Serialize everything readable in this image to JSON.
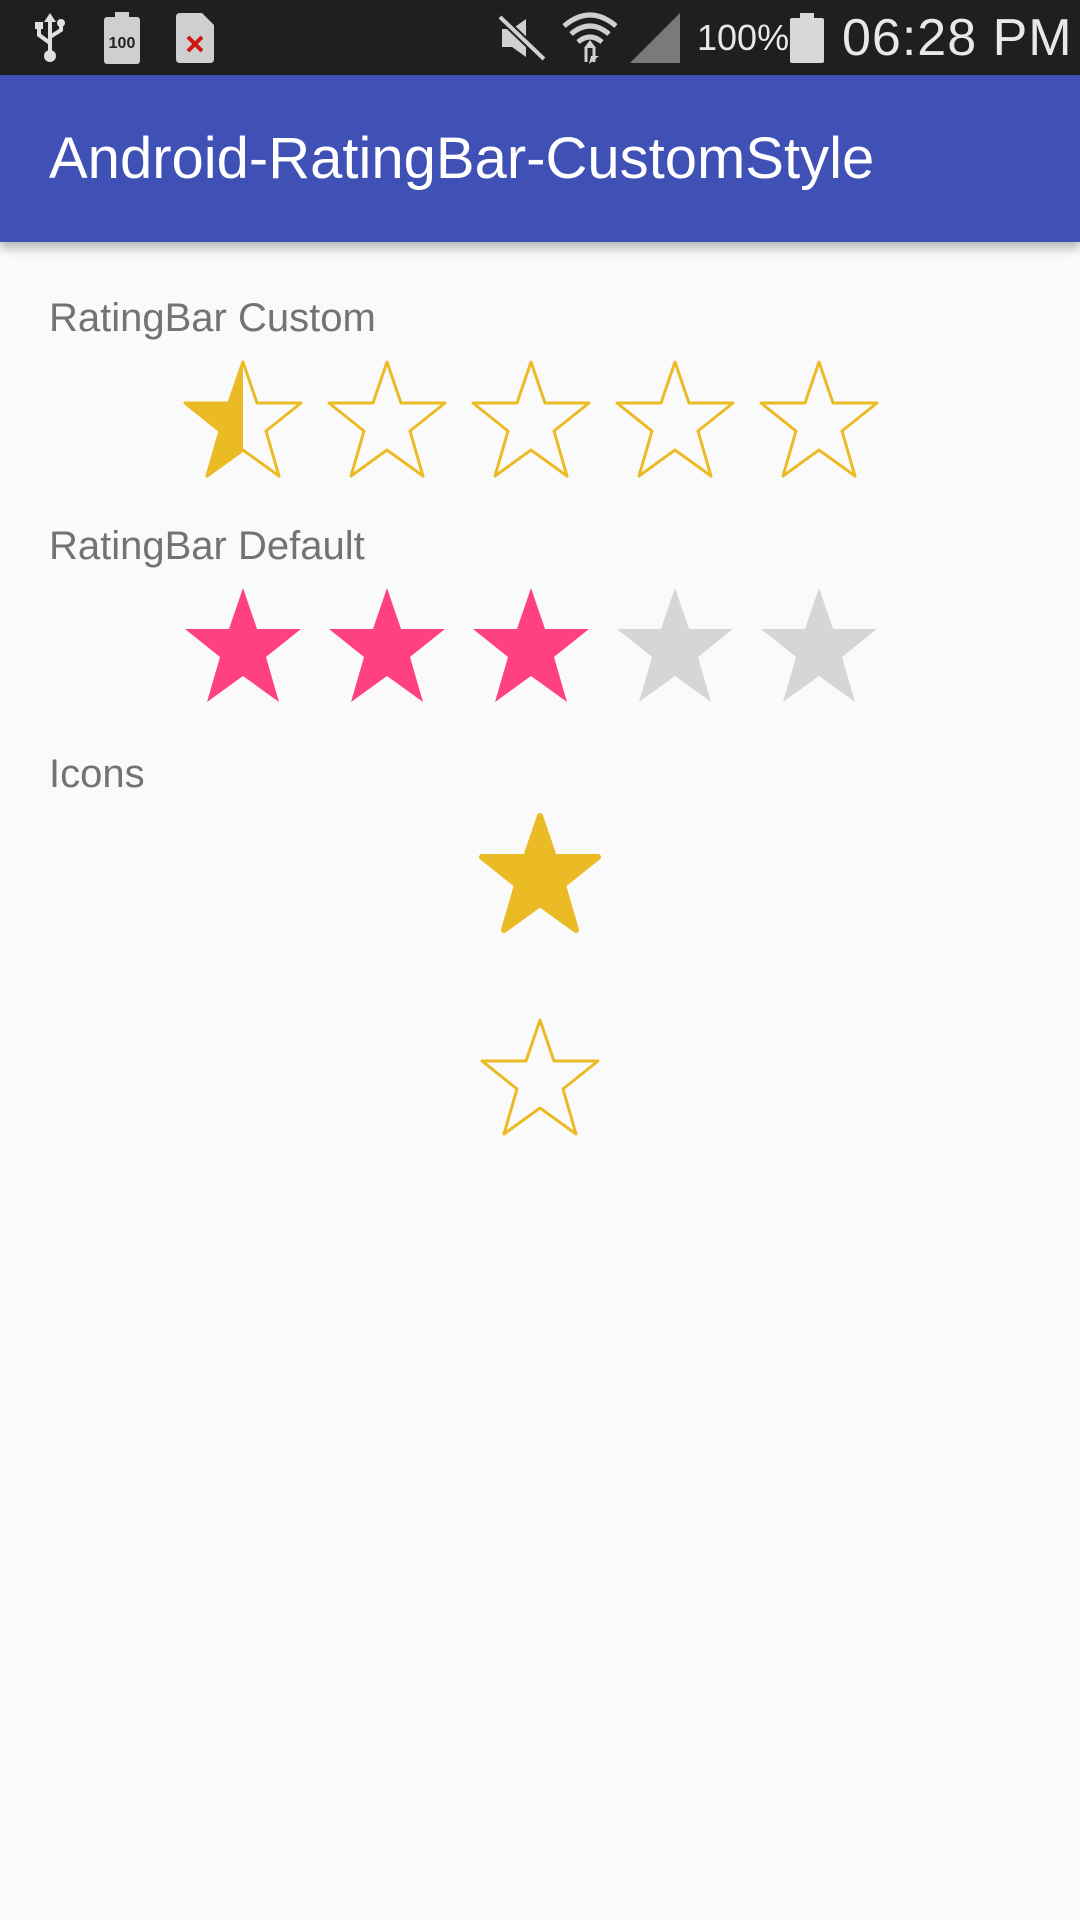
{
  "status_bar": {
    "left_icons": [
      "usb-icon",
      "battery-100-icon",
      "sim-error-icon"
    ],
    "right_icons": [
      "mute-icon",
      "wifi-icon",
      "signal-icon",
      "battery-icon"
    ],
    "battery_percent": "100%",
    "time": "06:28 PM"
  },
  "app_bar": {
    "title": "Android-RatingBar-CustomStyle",
    "color": "#3f51b5"
  },
  "custom_rating": {
    "label": "RatingBar Custom",
    "rating": 0.5,
    "max": 5,
    "color": "#ebbb26"
  },
  "default_rating": {
    "label": "RatingBar Default",
    "rating": 3,
    "max": 5,
    "active_color": "#ff4081",
    "inactive_color": "#d6d6d6"
  },
  "icons_section": {
    "label": "Icons",
    "icons": [
      "star-filled-icon",
      "star-outline-icon"
    ],
    "color": "#ebbb26"
  }
}
